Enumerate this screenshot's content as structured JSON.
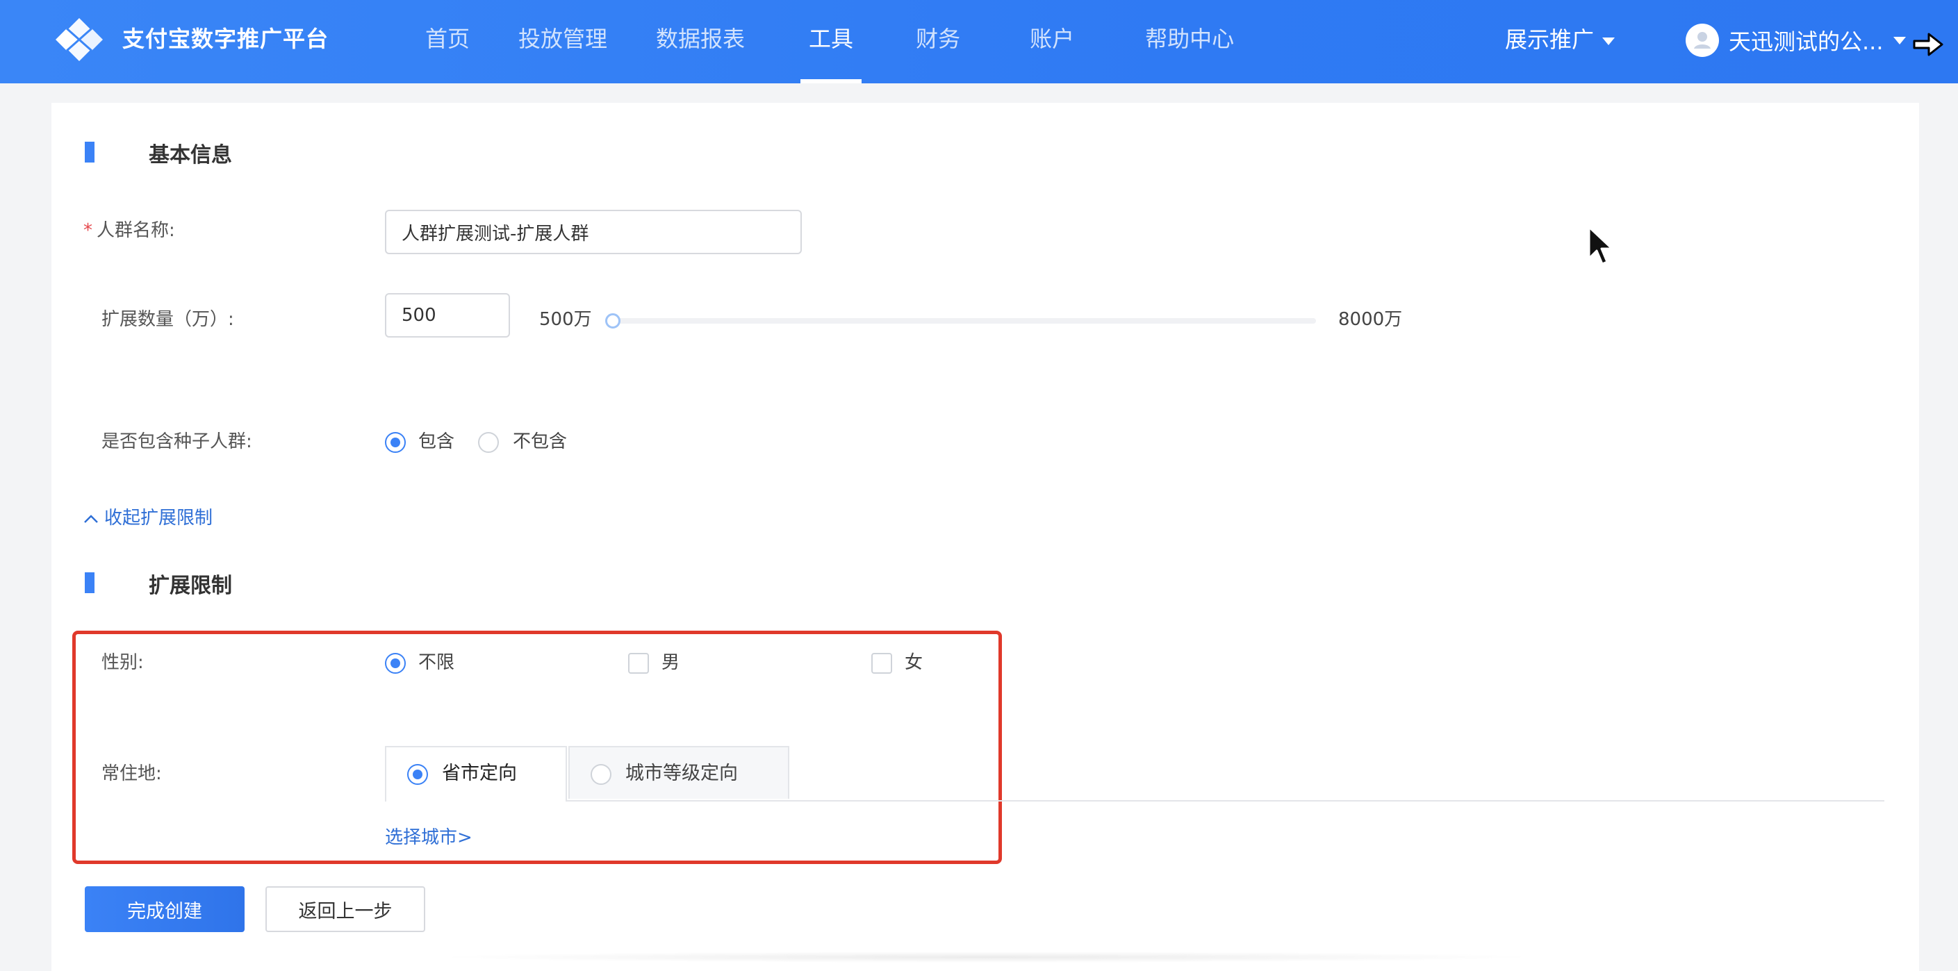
{
  "header": {
    "brand": "支付宝数字推广平台",
    "nav": [
      {
        "label": "首页",
        "active": false
      },
      {
        "label": "投放管理",
        "active": false
      },
      {
        "label": "数据报表",
        "active": false
      },
      {
        "label": "工具",
        "active": true
      },
      {
        "label": "财务",
        "active": false
      },
      {
        "label": "账户",
        "active": false
      },
      {
        "label": "帮助中心",
        "active": false
      }
    ],
    "promo_label": "展示推广",
    "user_name": "天迅测试的公..."
  },
  "basic_info": {
    "section_title": "基本信息",
    "audience_name_label": "人群名称:",
    "audience_name_value": "人群扩展测试-扩展人群",
    "expand_count_label": "扩展数量（万）:",
    "expand_count_value": "500",
    "slider_min_label": "500万",
    "slider_max_label": "8000万",
    "slider_value_fraction": 0,
    "include_seed_label": "是否包含种子人群:",
    "include_option": "包含",
    "exclude_option": "不包含",
    "include_selected": true
  },
  "collapse_link": "收起扩展限制",
  "restrictions": {
    "section_title": "扩展限制",
    "gender_label": "性别:",
    "gender_options": [
      "不限",
      "男",
      "女"
    ],
    "gender_selected": "不限",
    "residence_label": "常住地:",
    "residence_tabs": [
      "省市定向",
      "城市等级定向"
    ],
    "residence_selected": "省市定向",
    "select_city_link": "选择城市>"
  },
  "actions": {
    "submit": "完成创建",
    "back": "返回上一步"
  },
  "colors": {
    "brand_blue": "#2f7af3",
    "accent": "#3b82f6",
    "highlight_border": "#e0392b",
    "link": "#2f6fd6"
  }
}
